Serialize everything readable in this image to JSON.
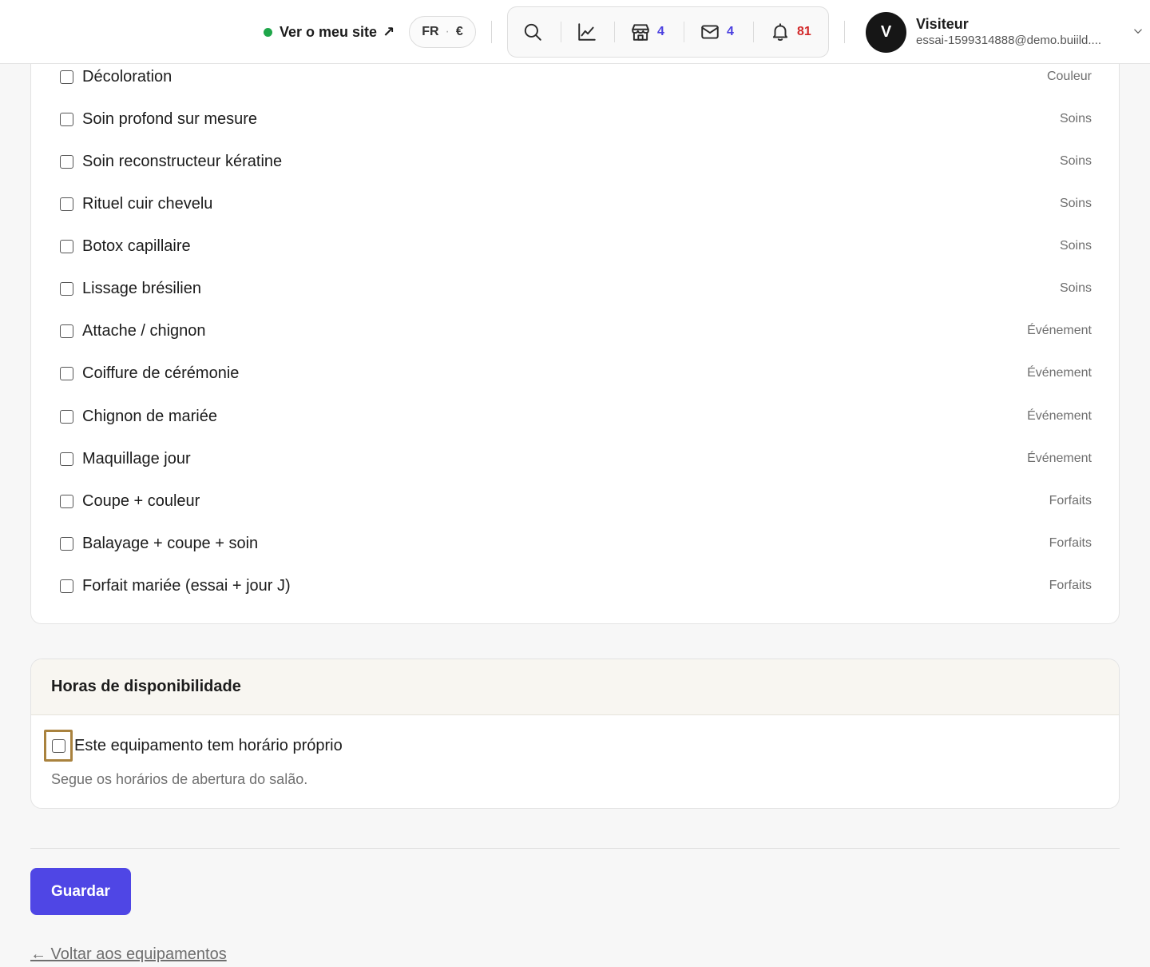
{
  "topbar": {
    "site_link_label": "Ver o meu site",
    "site_link_arrow": "↗",
    "locale": {
      "language": "FR",
      "separator": "·",
      "currency": "€"
    },
    "tools": [
      {
        "name": "search",
        "count": ""
      },
      {
        "name": "analytics",
        "count": ""
      },
      {
        "name": "store",
        "count": "4"
      },
      {
        "name": "mail",
        "count": "4"
      },
      {
        "name": "notifications",
        "count": "81"
      }
    ],
    "user": {
      "initial": "V",
      "name": "Visiteur",
      "email": "essai-1599314888@demo.buiild...."
    }
  },
  "services": [
    {
      "name": "Décoloration",
      "category": "Couleur",
      "checked": false
    },
    {
      "name": "Soin profond sur mesure",
      "category": "Soins",
      "checked": false
    },
    {
      "name": "Soin reconstructeur kératine",
      "category": "Soins",
      "checked": false
    },
    {
      "name": "Rituel cuir chevelu",
      "category": "Soins",
      "checked": false
    },
    {
      "name": "Botox capillaire",
      "category": "Soins",
      "checked": false
    },
    {
      "name": "Lissage brésilien",
      "category": "Soins",
      "checked": false
    },
    {
      "name": "Attache / chignon",
      "category": "Événement",
      "checked": false
    },
    {
      "name": "Coiffure de cérémonie",
      "category": "Événement",
      "checked": false
    },
    {
      "name": "Chignon de mariée",
      "category": "Événement",
      "checked": false
    },
    {
      "name": "Maquillage jour",
      "category": "Événement",
      "checked": false
    },
    {
      "name": "Coupe + couleur",
      "category": "Forfaits",
      "checked": false
    },
    {
      "name": "Balayage + coupe + soin",
      "category": "Forfaits",
      "checked": false
    },
    {
      "name": "Forfait mariée (essai + jour J)",
      "category": "Forfaits",
      "checked": false
    }
  ],
  "availability": {
    "title": "Horas de disponibilidade",
    "own_schedule_label": "Este equipamento tem horário próprio",
    "own_schedule_checked": false,
    "help_text": "Segue os horários de abertura do salão."
  },
  "actions": {
    "save_label": "Guardar",
    "back_label": "← Voltar aos equipamentos"
  },
  "colors": {
    "accent": "#4f46e5",
    "focus": "#a9823e",
    "live": "#1fa64a",
    "badge_blue": "#4a3fe0",
    "badge_red": "#d2292a"
  }
}
